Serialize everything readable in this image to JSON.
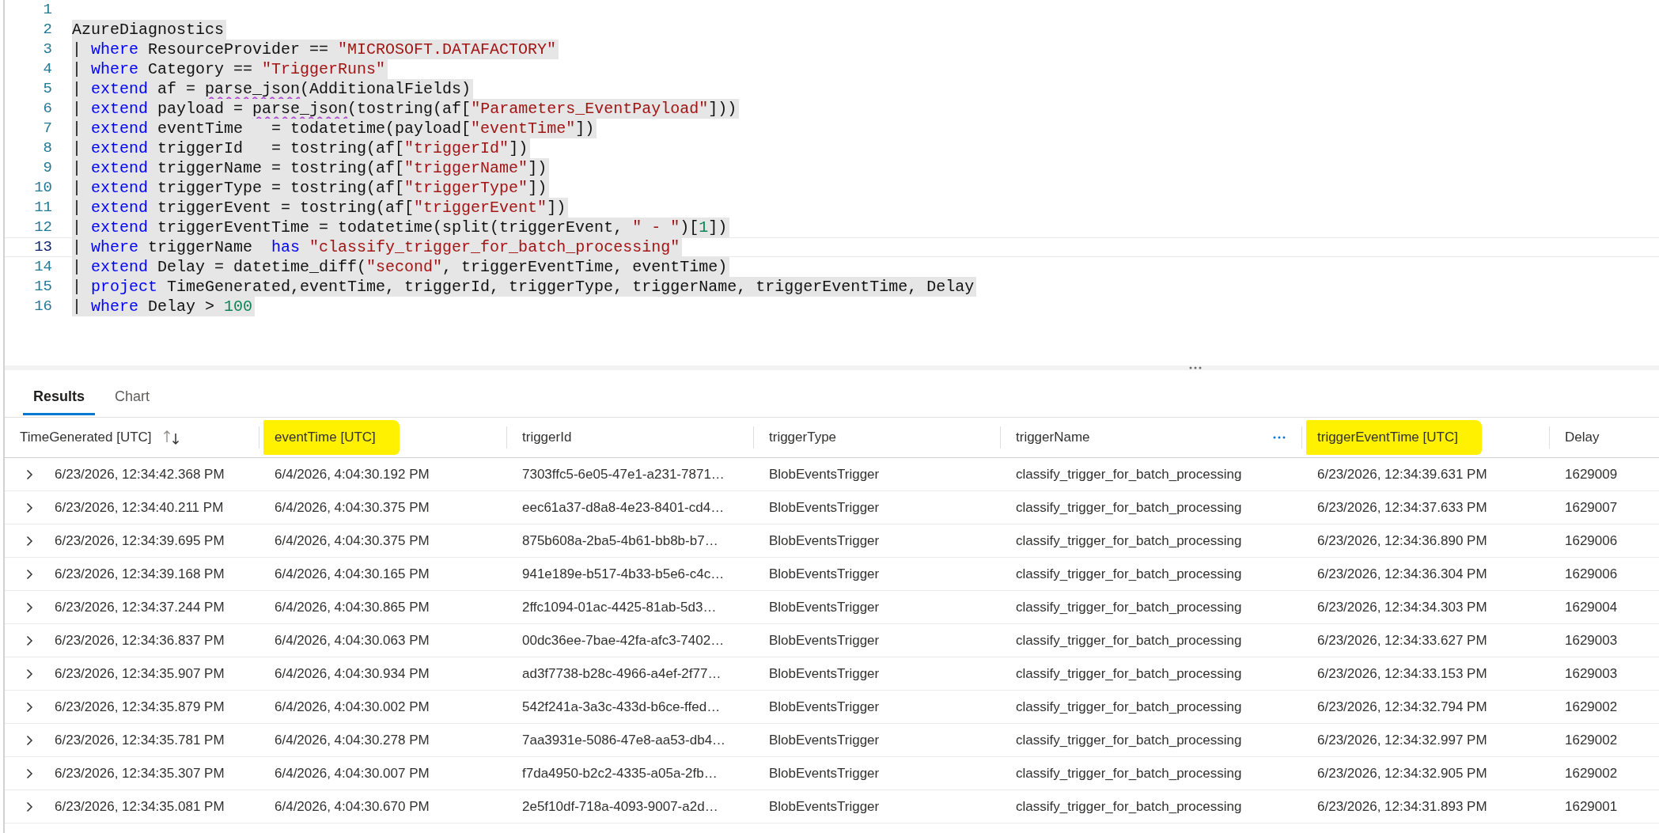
{
  "editor": {
    "lines": [
      {
        "number": "1",
        "selected": false,
        "active": false
      },
      {
        "number": "2",
        "selected": true,
        "active": false,
        "tokens": [
          {
            "kind": "plain",
            "text": "AzureDiagnostics"
          }
        ]
      },
      {
        "number": "3",
        "selected": true,
        "active": false,
        "tokens": [
          {
            "kind": "plain",
            "text": "| "
          },
          {
            "kind": "keyword",
            "text": "where"
          },
          {
            "kind": "plain",
            "text": " ResourceProvider == "
          },
          {
            "kind": "string",
            "text": "\"MICROSOFT.DATAFACTORY\""
          }
        ]
      },
      {
        "number": "4",
        "selected": true,
        "active": false,
        "tokens": [
          {
            "kind": "plain",
            "text": "| "
          },
          {
            "kind": "keyword",
            "text": "where"
          },
          {
            "kind": "plain",
            "text": " Category == "
          },
          {
            "kind": "string",
            "text": "\"TriggerRuns\""
          }
        ]
      },
      {
        "number": "5",
        "selected": true,
        "active": false,
        "tokens": [
          {
            "kind": "plain",
            "text": "| "
          },
          {
            "kind": "keyword",
            "text": "extend"
          },
          {
            "kind": "plain",
            "text": " af = "
          },
          {
            "kind": "flagged",
            "text": "parse_json"
          },
          {
            "kind": "plain",
            "text": "(AdditionalFields)"
          }
        ]
      },
      {
        "number": "6",
        "selected": true,
        "active": false,
        "tokens": [
          {
            "kind": "plain",
            "text": "| "
          },
          {
            "kind": "keyword",
            "text": "extend"
          },
          {
            "kind": "plain",
            "text": " payload = "
          },
          {
            "kind": "flagged",
            "text": "parse_json"
          },
          {
            "kind": "plain",
            "text": "(tostring(af["
          },
          {
            "kind": "string",
            "text": "\"Parameters_EventPayload\""
          },
          {
            "kind": "plain",
            "text": "]))"
          }
        ]
      },
      {
        "number": "7",
        "selected": true,
        "active": false,
        "tokens": [
          {
            "kind": "plain",
            "text": "| "
          },
          {
            "kind": "keyword",
            "text": "extend"
          },
          {
            "kind": "plain",
            "text": " eventTime   = todatetime(payload["
          },
          {
            "kind": "string",
            "text": "\"eventTime\""
          },
          {
            "kind": "plain",
            "text": "])"
          }
        ]
      },
      {
        "number": "8",
        "selected": true,
        "active": false,
        "tokens": [
          {
            "kind": "plain",
            "text": "| "
          },
          {
            "kind": "keyword",
            "text": "extend"
          },
          {
            "kind": "plain",
            "text": " triggerId   = tostring(af["
          },
          {
            "kind": "string",
            "text": "\"triggerId\""
          },
          {
            "kind": "plain",
            "text": "])"
          }
        ]
      },
      {
        "number": "9",
        "selected": true,
        "active": false,
        "tokens": [
          {
            "kind": "plain",
            "text": "| "
          },
          {
            "kind": "keyword",
            "text": "extend"
          },
          {
            "kind": "plain",
            "text": " triggerName = tostring(af["
          },
          {
            "kind": "string",
            "text": "\"triggerName\""
          },
          {
            "kind": "plain",
            "text": "])"
          }
        ]
      },
      {
        "number": "10",
        "selected": true,
        "active": false,
        "tokens": [
          {
            "kind": "plain",
            "text": "| "
          },
          {
            "kind": "keyword",
            "text": "extend"
          },
          {
            "kind": "plain",
            "text": " triggerType = tostring(af["
          },
          {
            "kind": "string",
            "text": "\"triggerType\""
          },
          {
            "kind": "plain",
            "text": "])"
          }
        ]
      },
      {
        "number": "11",
        "selected": true,
        "active": false,
        "tokens": [
          {
            "kind": "plain",
            "text": "| "
          },
          {
            "kind": "keyword",
            "text": "extend"
          },
          {
            "kind": "plain",
            "text": " triggerEvent = tostring(af["
          },
          {
            "kind": "string",
            "text": "\"triggerEvent\""
          },
          {
            "kind": "plain",
            "text": "])"
          }
        ]
      },
      {
        "number": "12",
        "selected": true,
        "active": false,
        "tokens": [
          {
            "kind": "plain",
            "text": "| "
          },
          {
            "kind": "keyword",
            "text": "extend"
          },
          {
            "kind": "plain",
            "text": " triggerEventTime = todatetime(split(triggerEvent, "
          },
          {
            "kind": "string",
            "text": "\" - \""
          },
          {
            "kind": "plain",
            "text": ")["
          },
          {
            "kind": "number",
            "text": "1"
          },
          {
            "kind": "plain",
            "text": "])"
          }
        ]
      },
      {
        "number": "13",
        "selected": true,
        "active": true,
        "tokens": [
          {
            "kind": "plain",
            "text": "| "
          },
          {
            "kind": "keyword",
            "text": "where"
          },
          {
            "kind": "plain",
            "text": " triggerName  "
          },
          {
            "kind": "keyword",
            "text": "has"
          },
          {
            "kind": "string",
            "text": " \"classify_trigger_for_batch_processing\""
          }
        ]
      },
      {
        "number": "14",
        "selected": true,
        "active": false,
        "tokens": [
          {
            "kind": "plain",
            "text": "| "
          },
          {
            "kind": "keyword",
            "text": "extend"
          },
          {
            "kind": "plain",
            "text": " Delay = datetime_diff("
          },
          {
            "kind": "string",
            "text": "\"second\""
          },
          {
            "kind": "plain",
            "text": ", triggerEventTime, eventTime)"
          }
        ]
      },
      {
        "number": "15",
        "selected": true,
        "active": false,
        "tokens": [
          {
            "kind": "plain",
            "text": "| "
          },
          {
            "kind": "keyword",
            "text": "project"
          },
          {
            "kind": "plain",
            "text": " TimeGenerated,eventTime, triggerId, triggerType, triggerName, triggerEventTime, Delay"
          }
        ]
      },
      {
        "number": "16",
        "selected": true,
        "active": false,
        "tokens": [
          {
            "kind": "plain",
            "text": "| "
          },
          {
            "kind": "keyword",
            "text": "where"
          },
          {
            "kind": "plain",
            "text": " Delay > "
          },
          {
            "kind": "number",
            "text": "100"
          }
        ]
      }
    ]
  },
  "results": {
    "tabs": [
      {
        "label": "Results",
        "selected": true
      },
      {
        "label": "Chart",
        "selected": false
      }
    ],
    "table": {
      "columns": [
        {
          "label": "TimeGenerated [UTC]",
          "highlighted": false,
          "sort_icon": true,
          "menu_icon": false
        },
        {
          "label": "eventTime [UTC]",
          "highlighted": true,
          "sort_icon": false,
          "menu_icon": false
        },
        {
          "label": "triggerId",
          "highlighted": false,
          "sort_icon": false,
          "menu_icon": false
        },
        {
          "label": "triggerType",
          "highlighted": false,
          "sort_icon": false,
          "menu_icon": false
        },
        {
          "label": "triggerName",
          "highlighted": false,
          "sort_icon": false,
          "menu_icon": true
        },
        {
          "label": "triggerEventTime [UTC]",
          "highlighted": true,
          "sort_icon": false,
          "menu_icon": false
        },
        {
          "label": "Delay",
          "highlighted": false,
          "sort_icon": false,
          "menu_icon": false
        }
      ],
      "rows": [
        {
          "expanded": false,
          "cells": [
            "6/23/2026, 12:34:42.368 PM",
            "6/4/2026, 4:04:30.192 PM",
            "7303ffc5-6e05-47e1-a231-7871…",
            "BlobEventsTrigger",
            "classify_trigger_for_batch_processing",
            "6/23/2026, 12:34:39.631 PM",
            "1629009"
          ]
        },
        {
          "expanded": false,
          "cells": [
            "6/23/2026, 12:34:40.211 PM",
            "6/4/2026, 4:04:30.375 PM",
            "eec61a37-d8a8-4e23-8401-cd4…",
            "BlobEventsTrigger",
            "classify_trigger_for_batch_processing",
            "6/23/2026, 12:34:37.633 PM",
            "1629007"
          ]
        },
        {
          "expanded": false,
          "cells": [
            "6/23/2026, 12:34:39.695 PM",
            "6/4/2026, 4:04:30.375 PM",
            "875b608a-2ba5-4b61-bb8b-b7…",
            "BlobEventsTrigger",
            "classify_trigger_for_batch_processing",
            "6/23/2026, 12:34:36.890 PM",
            "1629006"
          ]
        },
        {
          "expanded": false,
          "cells": [
            "6/23/2026, 12:34:39.168 PM",
            "6/4/2026, 4:04:30.165 PM",
            "941e189e-b517-4b33-b5e6-c4c…",
            "BlobEventsTrigger",
            "classify_trigger_for_batch_processing",
            "6/23/2026, 12:34:36.304 PM",
            "1629006"
          ]
        },
        {
          "expanded": false,
          "cells": [
            "6/23/2026, 12:34:37.244 PM",
            "6/4/2026, 4:04:30.865 PM",
            "2ffc1094-01ac-4425-81ab-5d3…",
            "BlobEventsTrigger",
            "classify_trigger_for_batch_processing",
            "6/23/2026, 12:34:34.303 PM",
            "1629004"
          ]
        },
        {
          "expanded": false,
          "cells": [
            "6/23/2026, 12:34:36.837 PM",
            "6/4/2026, 4:04:30.063 PM",
            "00dc36ee-7bae-42fa-afc3-7402…",
            "BlobEventsTrigger",
            "classify_trigger_for_batch_processing",
            "6/23/2026, 12:34:33.627 PM",
            "1629003"
          ]
        },
        {
          "expanded": false,
          "cells": [
            "6/23/2026, 12:34:35.907 PM",
            "6/4/2026, 4:04:30.934 PM",
            "ad3f7738-b28c-4966-a4ef-2f77…",
            "BlobEventsTrigger",
            "classify_trigger_for_batch_processing",
            "6/23/2026, 12:34:33.153 PM",
            "1629003"
          ]
        },
        {
          "expanded": false,
          "cells": [
            "6/23/2026, 12:34:35.879 PM",
            "6/4/2026, 4:04:30.002 PM",
            "542f241a-3a3c-433d-b6ce-ffed…",
            "BlobEventsTrigger",
            "classify_trigger_for_batch_processing",
            "6/23/2026, 12:34:32.794 PM",
            "1629002"
          ]
        },
        {
          "expanded": false,
          "cells": [
            "6/23/2026, 12:34:35.781 PM",
            "6/4/2026, 4:04:30.278 PM",
            "7aa3931e-5086-47e8-aa53-db4…",
            "BlobEventsTrigger",
            "classify_trigger_for_batch_processing",
            "6/23/2026, 12:34:32.997 PM",
            "1629002"
          ]
        },
        {
          "expanded": false,
          "cells": [
            "6/23/2026, 12:34:35.307 PM",
            "6/4/2026, 4:04:30.007 PM",
            "f7da4950-b2c2-4335-a05a-2fb…",
            "BlobEventsTrigger",
            "classify_trigger_for_batch_processing",
            "6/23/2026, 12:34:32.905 PM",
            "1629002"
          ]
        },
        {
          "expanded": false,
          "cells": [
            "6/23/2026, 12:34:35.081 PM",
            "6/4/2026, 4:04:30.670 PM",
            "2e5f10df-718a-4093-9007-a2d…",
            "BlobEventsTrigger",
            "classify_trigger_for_batch_processing",
            "6/23/2026, 12:34:31.893 PM",
            "1629001"
          ]
        }
      ]
    }
  }
}
